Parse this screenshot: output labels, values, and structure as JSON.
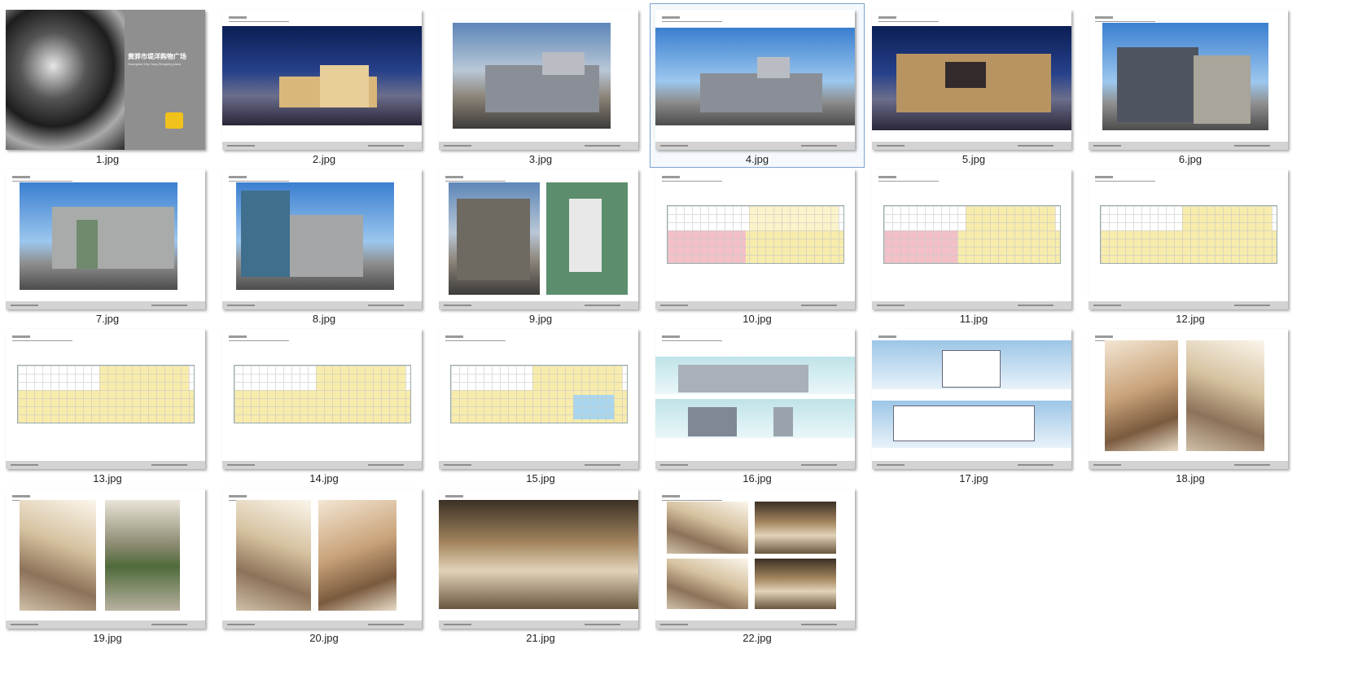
{
  "window": {
    "selected_item": "4.jpg"
  },
  "cover": {
    "title": "黄骅市堤洋购物广场",
    "subtitle": "Huanghua City Yang Shopping plaza"
  },
  "files": [
    {
      "name": "1.jpg"
    },
    {
      "name": "2.jpg"
    },
    {
      "name": "3.jpg"
    },
    {
      "name": "4.jpg"
    },
    {
      "name": "5.jpg"
    },
    {
      "name": "6.jpg"
    },
    {
      "name": "7.jpg"
    },
    {
      "name": "8.jpg"
    },
    {
      "name": "9.jpg"
    },
    {
      "name": "10.jpg"
    },
    {
      "name": "11.jpg"
    },
    {
      "name": "12.jpg"
    },
    {
      "name": "13.jpg"
    },
    {
      "name": "14.jpg"
    },
    {
      "name": "15.jpg"
    },
    {
      "name": "16.jpg"
    },
    {
      "name": "17.jpg"
    },
    {
      "name": "18.jpg"
    },
    {
      "name": "19.jpg"
    },
    {
      "name": "20.jpg"
    },
    {
      "name": "21.jpg"
    },
    {
      "name": "22.jpg"
    }
  ]
}
